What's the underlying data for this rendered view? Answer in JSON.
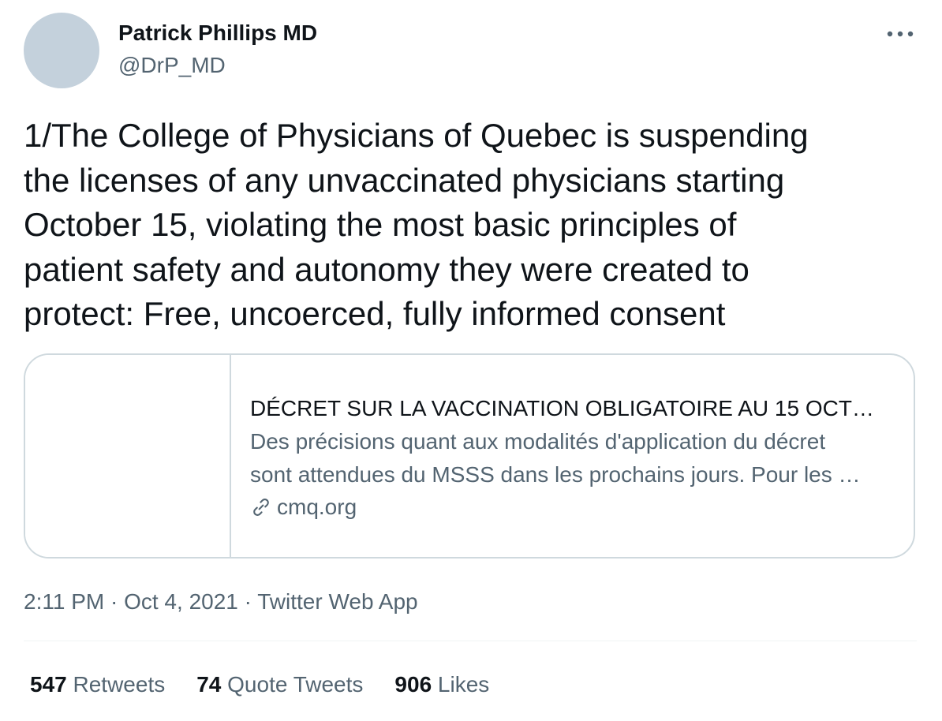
{
  "author": {
    "name": "Patrick Phillips MD",
    "handle": "@DrP_MD"
  },
  "more_icon": "more-horizontal-icon",
  "tweet": {
    "lines": [
      "1/The College of Physicians of Quebec is suspending",
      "the licenses of any unvaccinated physicians starting",
      "October 15, violating the most basic principles of",
      "patient safety and autonomy they were created to",
      "protect: Free, uncoerced, fully informed consent"
    ]
  },
  "card": {
    "title": "DÉCRET SUR LA VACCINATION OBLIGATOIRE AU 15 OCT…",
    "description_lines": [
      "Des précisions quant aux modalités d'application du décret",
      "sont attendues du MSSS dans les prochains jours. Pour les …"
    ],
    "domain": "cmq.org",
    "domain_icon": "link-icon"
  },
  "meta": {
    "time": "2:11 PM",
    "separator": " · ",
    "date": "Oct 4, 2021",
    "source": "Twitter Web App"
  },
  "stats": {
    "retweets": {
      "count": "547",
      "label": "Retweets"
    },
    "quotes": {
      "count": "74",
      "label": "Quote Tweets"
    },
    "likes": {
      "count": "906",
      "label": "Likes"
    }
  },
  "colors": {
    "text_primary": "#0f1419",
    "text_secondary": "#536471",
    "border": "#cfd9de",
    "avatar_placeholder": "#c4d1dc"
  }
}
